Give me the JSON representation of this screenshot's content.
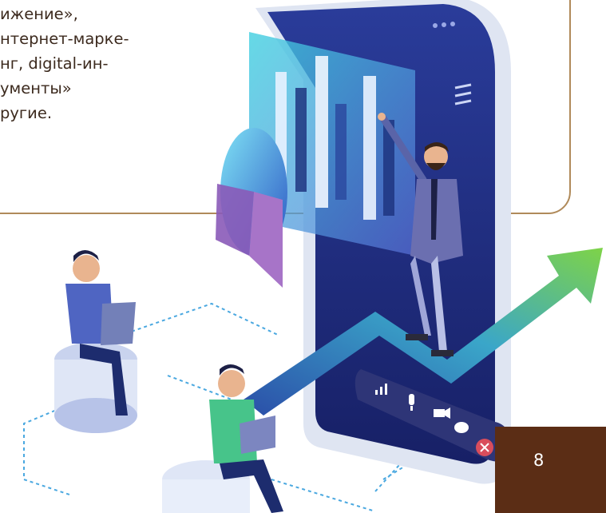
{
  "text_lines": [
    "ижение»,",
    "нтернет-марке-",
    "нг, digital-ин-",
    "ументы»",
    "ругие."
  ],
  "page_number": "8",
  "colors": {
    "frame_border": "#b08a5a",
    "text": "#3c2a1e",
    "corner_bar": "#5b2d15",
    "phone_screen": "#1f2a7a",
    "arrow_green": "#6cc24a"
  },
  "icons": [
    "signal-bars-icon",
    "microphone-icon",
    "video-camera-icon",
    "chat-bubble-icon",
    "close-icon"
  ]
}
